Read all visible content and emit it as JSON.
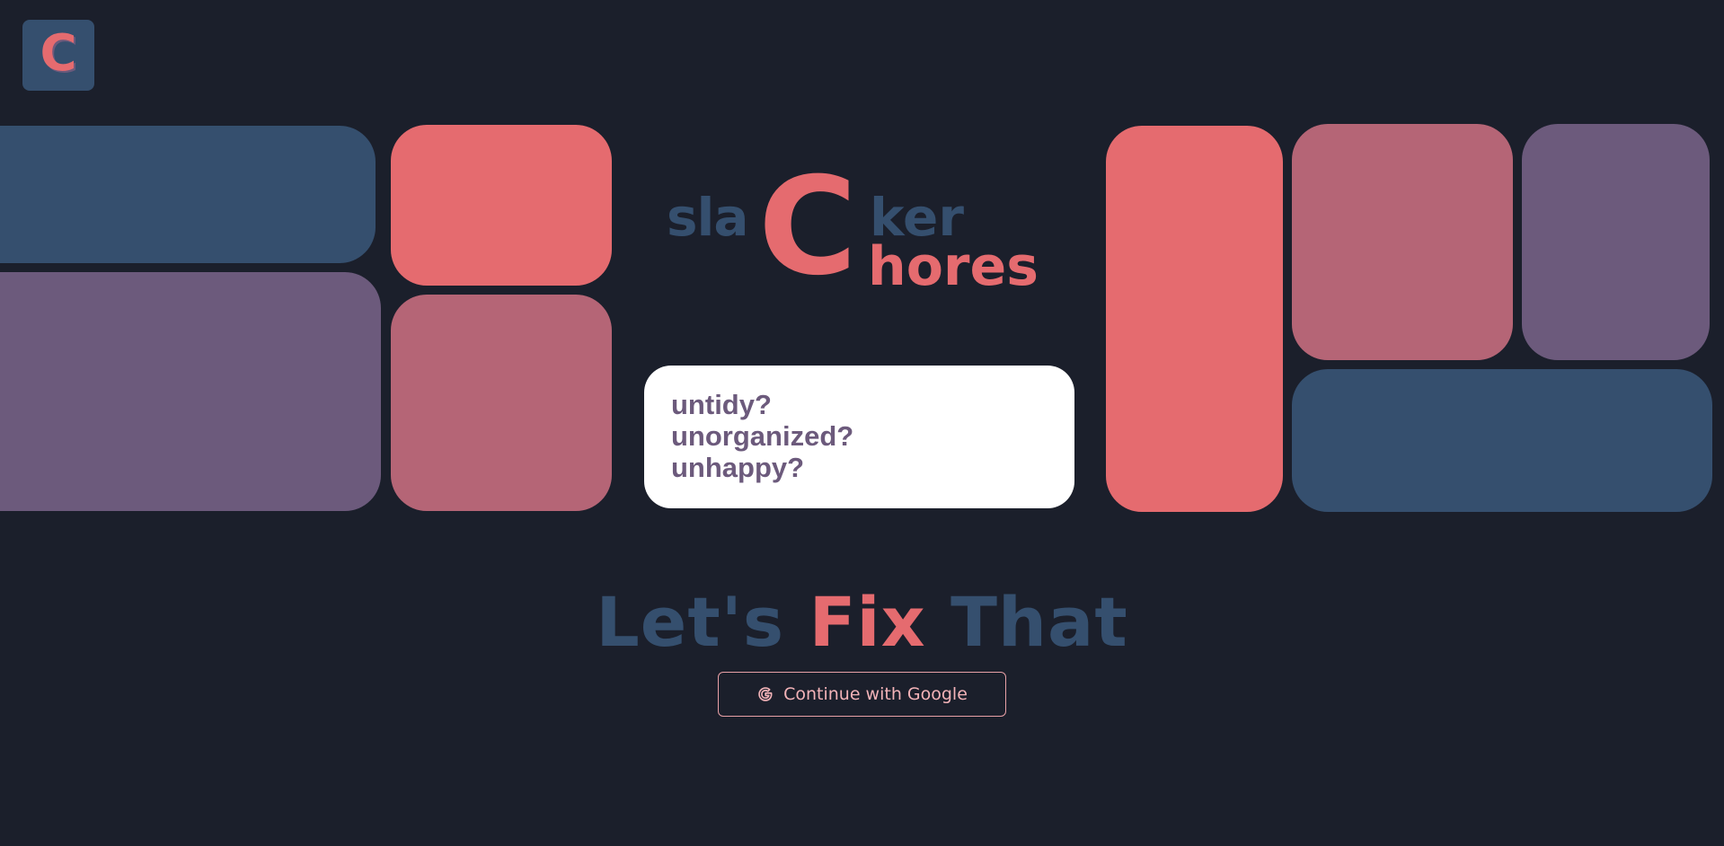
{
  "app": {
    "logo_letter": "C",
    "brand_parts": {
      "prefix": "sla",
      "big_letter": "C",
      "suffix": "ker",
      "second_word": "hores"
    }
  },
  "card": {
    "lines": [
      "untidy?",
      "unorganized?",
      "unhappy?"
    ]
  },
  "headline": {
    "part1": "Let's",
    "highlight": "Fix",
    "part2": "That"
  },
  "auth": {
    "google_label": "Continue with Google",
    "google_icon": "google-g-icon"
  },
  "colors": {
    "background": "#1b1f2b",
    "blue": "#354f6e",
    "coral": "#e56b6f",
    "rose": "#b56576",
    "plum": "#6c5a7c",
    "card": "#ffffff"
  }
}
